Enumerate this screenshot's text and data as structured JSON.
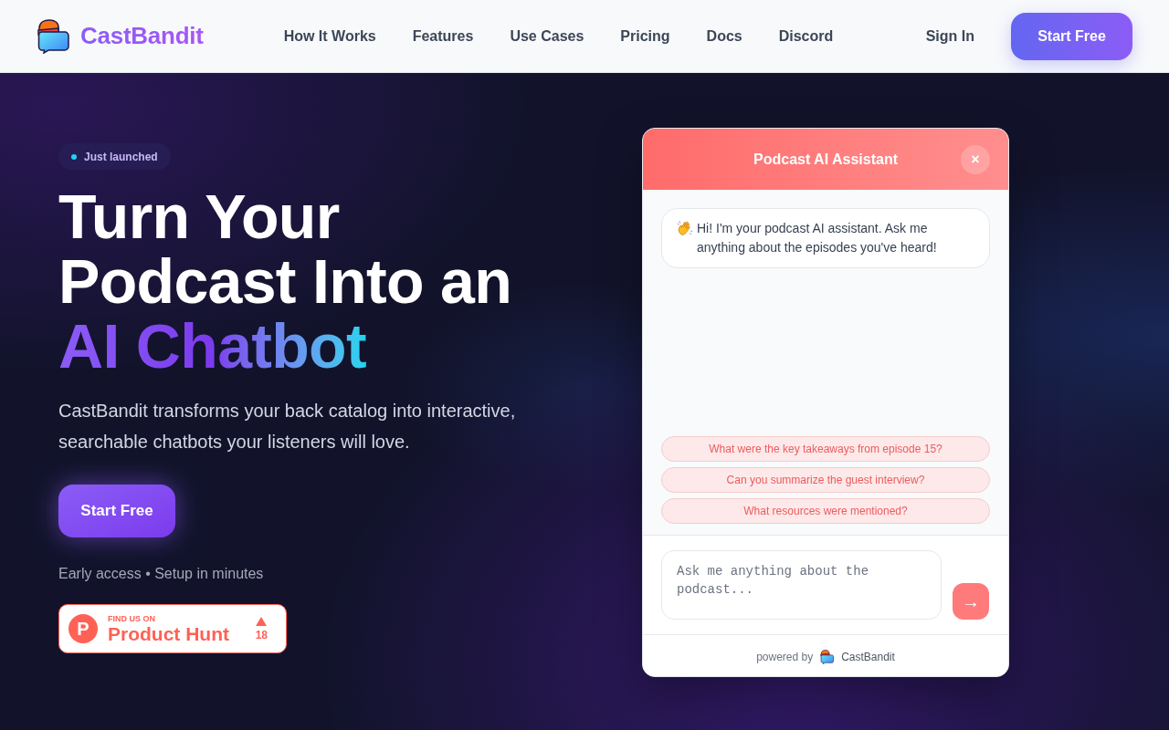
{
  "header": {
    "brand": "CastBandit",
    "nav": [
      "How It Works",
      "Features",
      "Use Cases",
      "Pricing",
      "Docs",
      "Discord"
    ],
    "sign_in": "Sign In",
    "cta": "Start Free"
  },
  "hero": {
    "badge": "Just launched",
    "heading_lines": [
      {
        "text": "Turn Your",
        "kind": "plain"
      },
      {
        "text": "Podcast Into an",
        "kind": "plain"
      },
      {
        "text": "AI Chatbot",
        "kind": "gradient"
      }
    ],
    "subtitle": "CastBandit transforms your back catalog into interactive, searchable chatbots your listeners will love.",
    "cta": "Start Free",
    "note": "Early access • Setup in minutes",
    "product_hunt": {
      "logo_letter": "P",
      "eyebrow": "FIND US ON",
      "name": "Product Hunt",
      "upvotes": "18"
    }
  },
  "chat_widget": {
    "title": "Podcast AI Assistant",
    "close": "×",
    "messages": [
      {
        "kind": "greeting",
        "text": "Hi! I'm your podcast AI assistant. Ask me anything about the episodes you've heard!"
      }
    ],
    "suggestions": [
      "What were the key takeaways from episode 15?",
      "Can you summarize the guest interview?",
      "What resources were mentioned?"
    ],
    "input": {
      "placeholder": "Ask me anything about the podcast..."
    },
    "send": "→",
    "footer": {
      "prefix": "powered by",
      "brand": "CastBandit"
    }
  }
}
